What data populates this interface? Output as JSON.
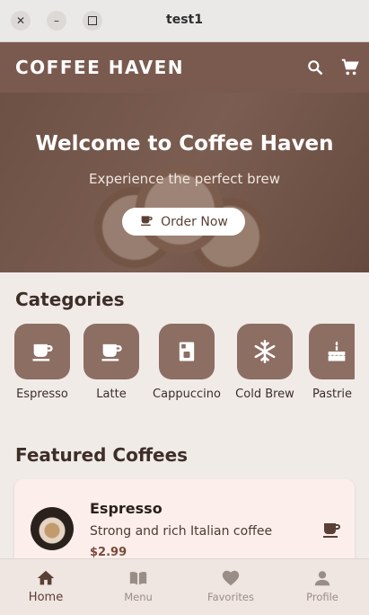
{
  "window": {
    "title": "test1",
    "close_icon": "close-icon",
    "minimize_icon": "minimize-icon",
    "maximize_icon": "maximize-icon"
  },
  "appbar": {
    "title": "COFFEE HAVEN",
    "icons": [
      "search-icon",
      "cart-icon"
    ]
  },
  "hero": {
    "title": "Welcome to Coffee Haven",
    "subtitle": "Experience the perfect brew",
    "button_label": "Order Now"
  },
  "categories": {
    "title": "Categories",
    "items": [
      {
        "label": "Espresso",
        "icon": "coffee-cup-icon"
      },
      {
        "label": "Latte",
        "icon": "coffee-cup-icon"
      },
      {
        "label": "Cappuccino",
        "icon": "coffee-maker-icon"
      },
      {
        "label": "Cold Brew",
        "icon": "snowflake-icon"
      },
      {
        "label": "Pastrie",
        "icon": "cake-icon"
      }
    ]
  },
  "featured": {
    "title": "Featured Coffees",
    "items": [
      {
        "name": "Espresso",
        "description": "Strong and rich Italian coffee",
        "price": "$2.99",
        "icon": "coffee-cup-icon"
      }
    ]
  },
  "bottom_nav": {
    "items": [
      {
        "label": "Home",
        "icon": "home-icon",
        "active": true
      },
      {
        "label": "Menu",
        "icon": "menu-book-icon",
        "active": false
      },
      {
        "label": "Favorites",
        "icon": "heart-icon",
        "active": false
      },
      {
        "label": "Profile",
        "icon": "person-icon",
        "active": false
      }
    ]
  },
  "colors": {
    "primary": "#7a5a4f",
    "accent": "#8d6e63",
    "background": "#f1ebe8",
    "card": "#fcefeb"
  }
}
